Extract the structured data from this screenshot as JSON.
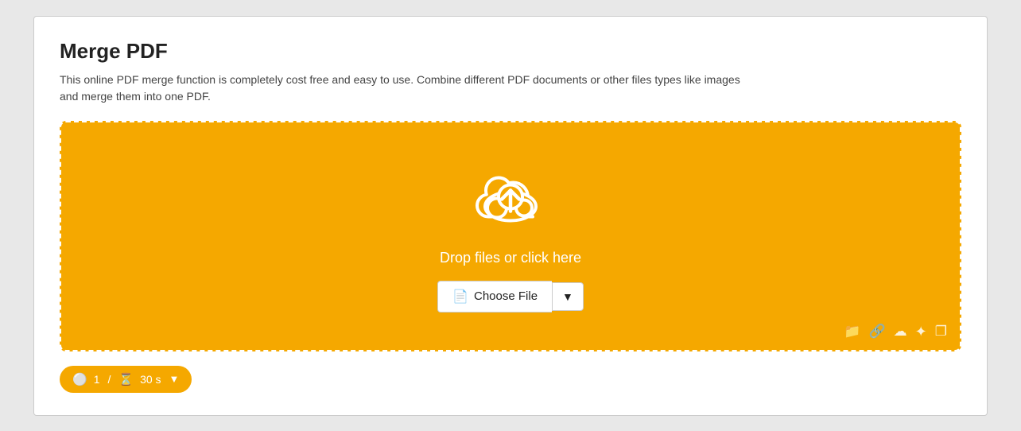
{
  "page": {
    "title": "Merge PDF",
    "description": "This online PDF merge function is completely cost free and easy to use. Combine different PDF documents or other files types like images and merge them into one PDF."
  },
  "upload": {
    "drop_text": "Drop files or click here",
    "choose_file_label": "Choose File",
    "choose_file_icon": "📄"
  },
  "footer": {
    "pages_icon": "🔴",
    "pages_count": "1",
    "pages_separator": "/",
    "time_icon": "⏱",
    "time_value": "30 s"
  },
  "bottom_icons": {
    "folder": "📁",
    "link": "🔗",
    "cloud_upload": "☁",
    "dropbox": "❖",
    "copy": "❐"
  },
  "colors": {
    "accent": "#F5A800",
    "white": "#ffffff",
    "dark": "#222222"
  }
}
